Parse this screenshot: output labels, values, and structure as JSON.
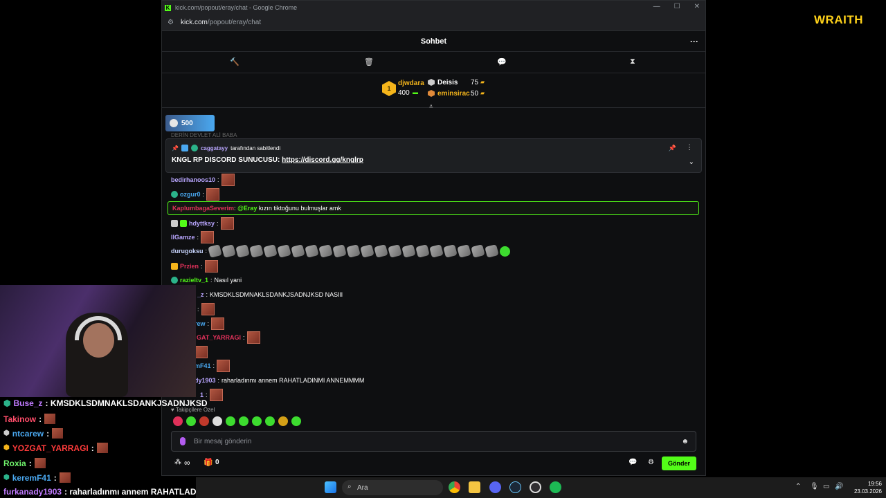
{
  "window": {
    "title": "kick.com/popout/eray/chat - Google Chrome",
    "url_host": "kick.com",
    "url_path": "/popout/eray/chat",
    "logo_letter": "K",
    "controls": [
      "—",
      "☐",
      "✕"
    ]
  },
  "chat": {
    "title": "Sohbet",
    "more": "···",
    "toolbar_icons": [
      "gavel-icon",
      "trash-icon",
      "chat-bubble-icon",
      "hourglass-icon"
    ],
    "leaderboard": {
      "rank1": {
        "rank": "1",
        "name": "djwdara",
        "amount": "400"
      },
      "rank2": {
        "name": "Deisis",
        "amount": "75"
      },
      "rank3": {
        "name": "eminsirac",
        "amount": "50"
      }
    },
    "pill_value": "500",
    "cut_message": "DERİN DEVLET ALİ BABA",
    "pinned": {
      "user": "caggatayy",
      "meta_text": "tarafından sabitlendi",
      "text": "KNGL RP DISCORD SUNUCUSU:",
      "link": "https://discord.gg/knglrp"
    },
    "messages": [
      {
        "user": "bedirhanoos10",
        "color": "#b9a6ff",
        "text": "",
        "emotes": 1
      },
      {
        "user": "ozgur0",
        "color": "#4aa8f0",
        "text": "",
        "emotes": 1
      },
      {
        "user": "hdyttksy",
        "color": "#b9a6ff",
        "text": "",
        "emotes": 1
      },
      {
        "user": "IlGamze",
        "color": "#b9a6ff",
        "text": "",
        "emotes": 1
      },
      {
        "user": "durugoksu",
        "color": "#c9d6ff",
        "text": "",
        "emotes": 22
      },
      {
        "user": "Przien",
        "color": "#e0315a",
        "text": "",
        "emotes": 1
      },
      {
        "user": "razieltv_1",
        "color": "#53fc18",
        "text": "Nasıl yani",
        "emotes": 0
      },
      {
        "user": "_z",
        "color": "#b9a6ff",
        "text": "KMSDKLSDMNAKLSDANKJSADNJKSD NASIlI",
        "emotes": 0
      },
      {
        "user": "",
        "color": "#fff",
        "text": "",
        "emotes": 1
      },
      {
        "user": "rew",
        "color": "#4aa8f0",
        "text": "",
        "emotes": 1
      },
      {
        "user": "GAT_YARRAGI",
        "color": "#e0315a",
        "text": "",
        "emotes": 1
      },
      {
        "user": "",
        "color": "#fff",
        "text": "",
        "emotes": 1
      },
      {
        "user": "mF41",
        "color": "#4aa8f0",
        "text": "",
        "emotes": 1
      },
      {
        "user": "dy1903",
        "color": "#b9a6ff",
        "text": "raharladınmı annem RAHATLADINMI ANNEMMMM",
        "emotes": 0
      },
      {
        "user": "1",
        "color": "#b9a6ff",
        "text": "",
        "emotes": 1
      }
    ],
    "mention": {
      "user": "KaplumbagaSeverim",
      "tag": "@Eray",
      "text": "kızın tiktoğunu bulmuşlar amk"
    },
    "followers_only": "Takipçilere Özel",
    "input_placeholder": "Bir mesaj gönderin",
    "bottom": {
      "points": "∞",
      "gifts": "0",
      "send_label": "Gönder"
    }
  },
  "overlay": {
    "brand": "WRAITH",
    "lines": [
      {
        "user": "Buse_z",
        "color": "#c07bff",
        "text": ": KMSDKLSDMNAKLSDANKJSADNJKSD",
        "emote": false
      },
      {
        "user": "Takinow",
        "color": "#ff4d6a",
        "text": ":",
        "emote": true
      },
      {
        "user": "ntcarew",
        "color": "#4aa8f0",
        "text": ":",
        "emote": true
      },
      {
        "user": "YOZGAT_YARRAGI",
        "color": "#ff3b3b",
        "text": ":",
        "emote": true
      },
      {
        "user": "Roxia",
        "color": "#6ef06a",
        "text": ":",
        "emote": true
      },
      {
        "user": "keremF41",
        "color": "#4aa8f0",
        "text": ":",
        "emote": true
      },
      {
        "user": "furkanady1903",
        "color": "#c07bff",
        "text": ": raharladınmı annem RAHATLADIN",
        "emote": false
      }
    ]
  },
  "taskbar": {
    "search_placeholder": "Ara",
    "time": "19:56",
    "date": "23.03.2026",
    "apps": [
      "windows-start-icon",
      "chrome-icon",
      "file-explorer-icon",
      "discord-icon",
      "steam-icon",
      "obs-icon",
      "spotify-icon"
    ]
  },
  "colors": {
    "kick_green": "#53fc18",
    "accent_purple": "#b9a6ff",
    "gold": "#f5b51b"
  }
}
